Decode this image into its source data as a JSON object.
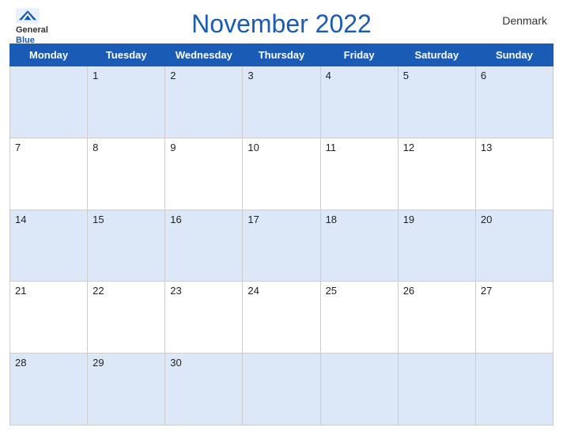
{
  "header": {
    "title": "November 2022",
    "country": "Denmark",
    "logo_general": "General",
    "logo_blue": "Blue"
  },
  "days_of_week": [
    "Monday",
    "Tuesday",
    "Wednesday",
    "Thursday",
    "Friday",
    "Saturday",
    "Sunday"
  ],
  "weeks": [
    {
      "row_style": "row-blue",
      "days": [
        {
          "num": "",
          "empty": true
        },
        {
          "num": "1"
        },
        {
          "num": "2"
        },
        {
          "num": "3"
        },
        {
          "num": "4"
        },
        {
          "num": "5"
        },
        {
          "num": "6"
        }
      ]
    },
    {
      "row_style": "row-white",
      "days": [
        {
          "num": "7"
        },
        {
          "num": "8"
        },
        {
          "num": "9"
        },
        {
          "num": "10"
        },
        {
          "num": "11"
        },
        {
          "num": "12"
        },
        {
          "num": "13"
        }
      ]
    },
    {
      "row_style": "row-blue",
      "days": [
        {
          "num": "14"
        },
        {
          "num": "15"
        },
        {
          "num": "16"
        },
        {
          "num": "17"
        },
        {
          "num": "18"
        },
        {
          "num": "19"
        },
        {
          "num": "20"
        }
      ]
    },
    {
      "row_style": "row-white",
      "days": [
        {
          "num": "21"
        },
        {
          "num": "22"
        },
        {
          "num": "23"
        },
        {
          "num": "24"
        },
        {
          "num": "25"
        },
        {
          "num": "26"
        },
        {
          "num": "27"
        }
      ]
    },
    {
      "row_style": "row-blue",
      "days": [
        {
          "num": "28"
        },
        {
          "num": "29"
        },
        {
          "num": "30"
        },
        {
          "num": "",
          "empty": true
        },
        {
          "num": "",
          "empty": true
        },
        {
          "num": "",
          "empty": true
        },
        {
          "num": "",
          "empty": true
        }
      ]
    }
  ]
}
